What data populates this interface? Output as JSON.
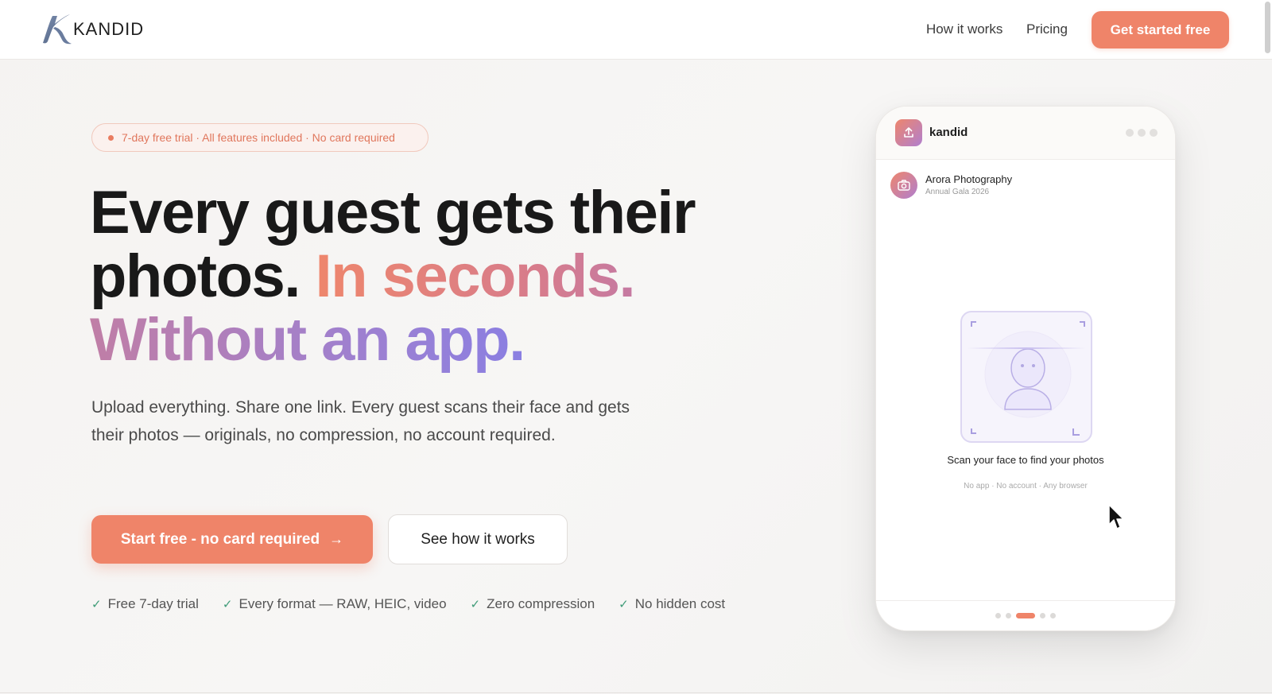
{
  "header": {
    "logo_text": "KANDID",
    "nav": [
      "How it works",
      "Pricing"
    ],
    "cta": "Get started free"
  },
  "hero": {
    "pill": "7-day free trial · All features included · No card required",
    "headline_line1": "Every guest gets their",
    "headline_line2_dark": "photos.",
    "headline_line2_accent": "In seconds.",
    "headline_line3_accent": "Without an app.",
    "subtext": "Upload everything. Share one link. Every guest scans their face and gets their photos — originals, no compression, no account required.",
    "primary_button": "Start free - no card required",
    "secondary_button": "See how it works",
    "features": [
      "Free 7-day trial",
      "Every format — RAW, HEIC, video",
      "Zero compression",
      "No hidden cost"
    ]
  },
  "phone": {
    "app_name": "kandid",
    "studio_name": "Arora Photography",
    "event_name": "Annual Gala 2026",
    "scan_caption": "Scan your face to find your photos",
    "scan_sub": "No app · No account · Any browser",
    "pager_total": 5,
    "pager_active": 3
  },
  "colors": {
    "accent": "#ef8469",
    "gradient_pink": "#d77c8c",
    "gradient_purple": "#8a7fe2",
    "check": "#3f9c78"
  }
}
